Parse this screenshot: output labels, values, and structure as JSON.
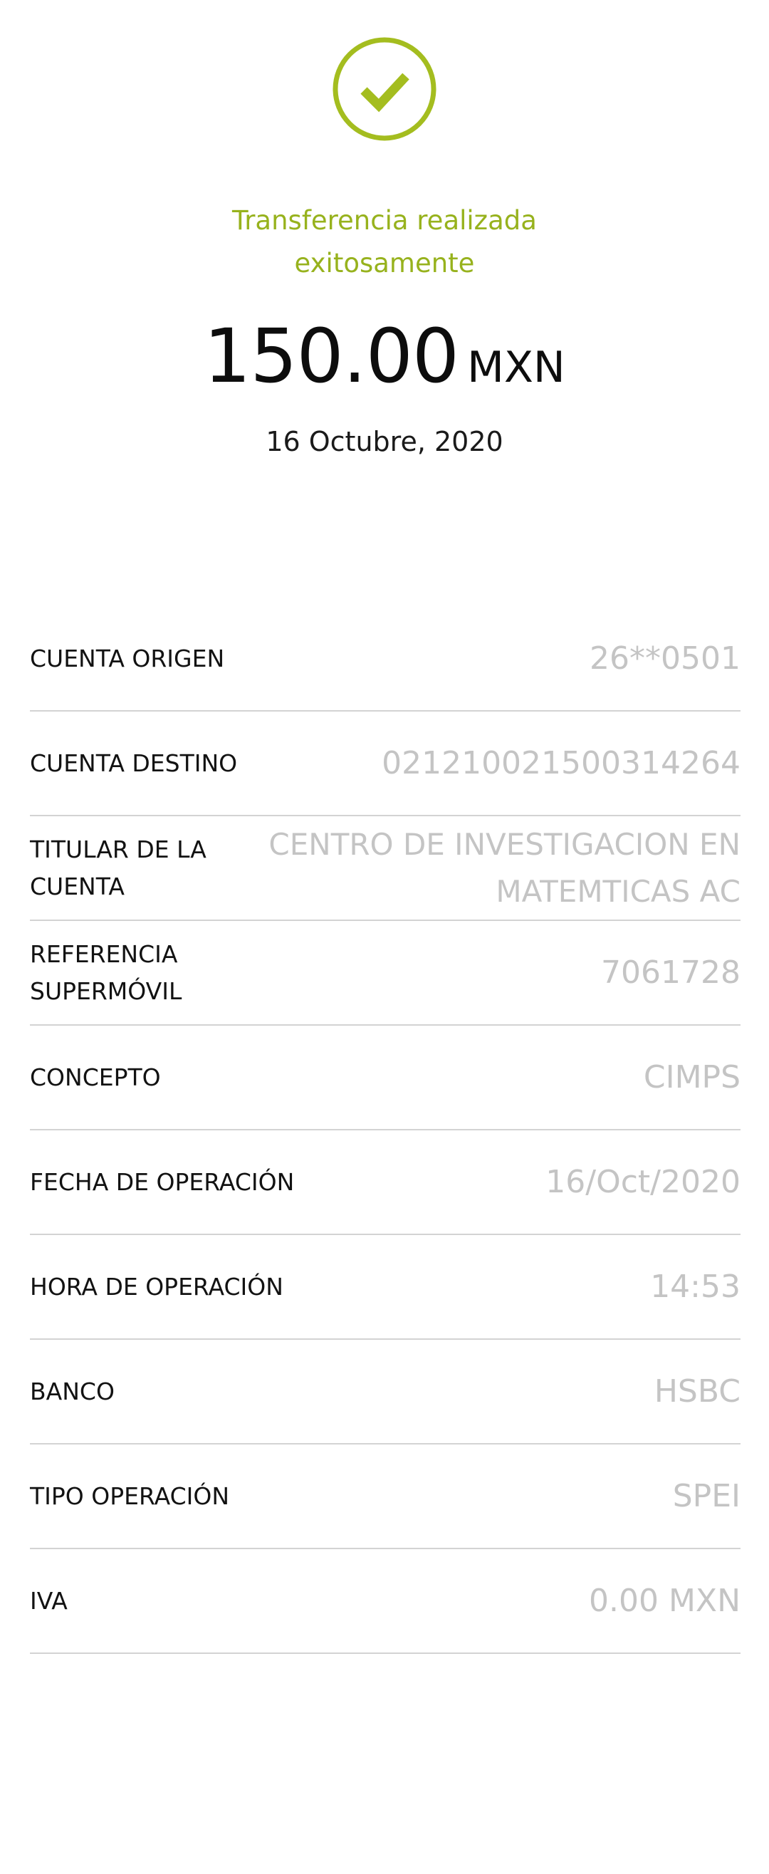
{
  "colors": {
    "accent": "#97b21d",
    "value_text": "#c4c4c4",
    "divider": "#d3d3d3"
  },
  "status": {
    "icon": "check-circle-icon",
    "message": "Transferencia realizada exitosamente"
  },
  "amount": {
    "value": "150.00",
    "currency": "MXN"
  },
  "date": "16 Octubre, 2020",
  "details": [
    {
      "label": "CUENTA ORIGEN",
      "value": "26**0501"
    },
    {
      "label": "CUENTA DESTINO",
      "value": "021210021500314264"
    },
    {
      "label": "TITULAR DE LA CUENTA",
      "value": "CENTRO DE INVESTIGACION EN MATEMTICAS AC"
    },
    {
      "label": "REFERENCIA SUPERMÓVIL",
      "value": "7061728"
    },
    {
      "label": "CONCEPTO",
      "value": "CIMPS"
    },
    {
      "label": "FECHA DE OPERACIÓN",
      "value": "16/Oct/2020"
    },
    {
      "label": "HORA DE OPERACIÓN",
      "value": "14:53"
    },
    {
      "label": "BANCO",
      "value": "HSBC"
    },
    {
      "label": "TIPO OPERACIÓN",
      "value": "SPEI"
    },
    {
      "label": "IVA",
      "value": "0.00 MXN"
    }
  ]
}
